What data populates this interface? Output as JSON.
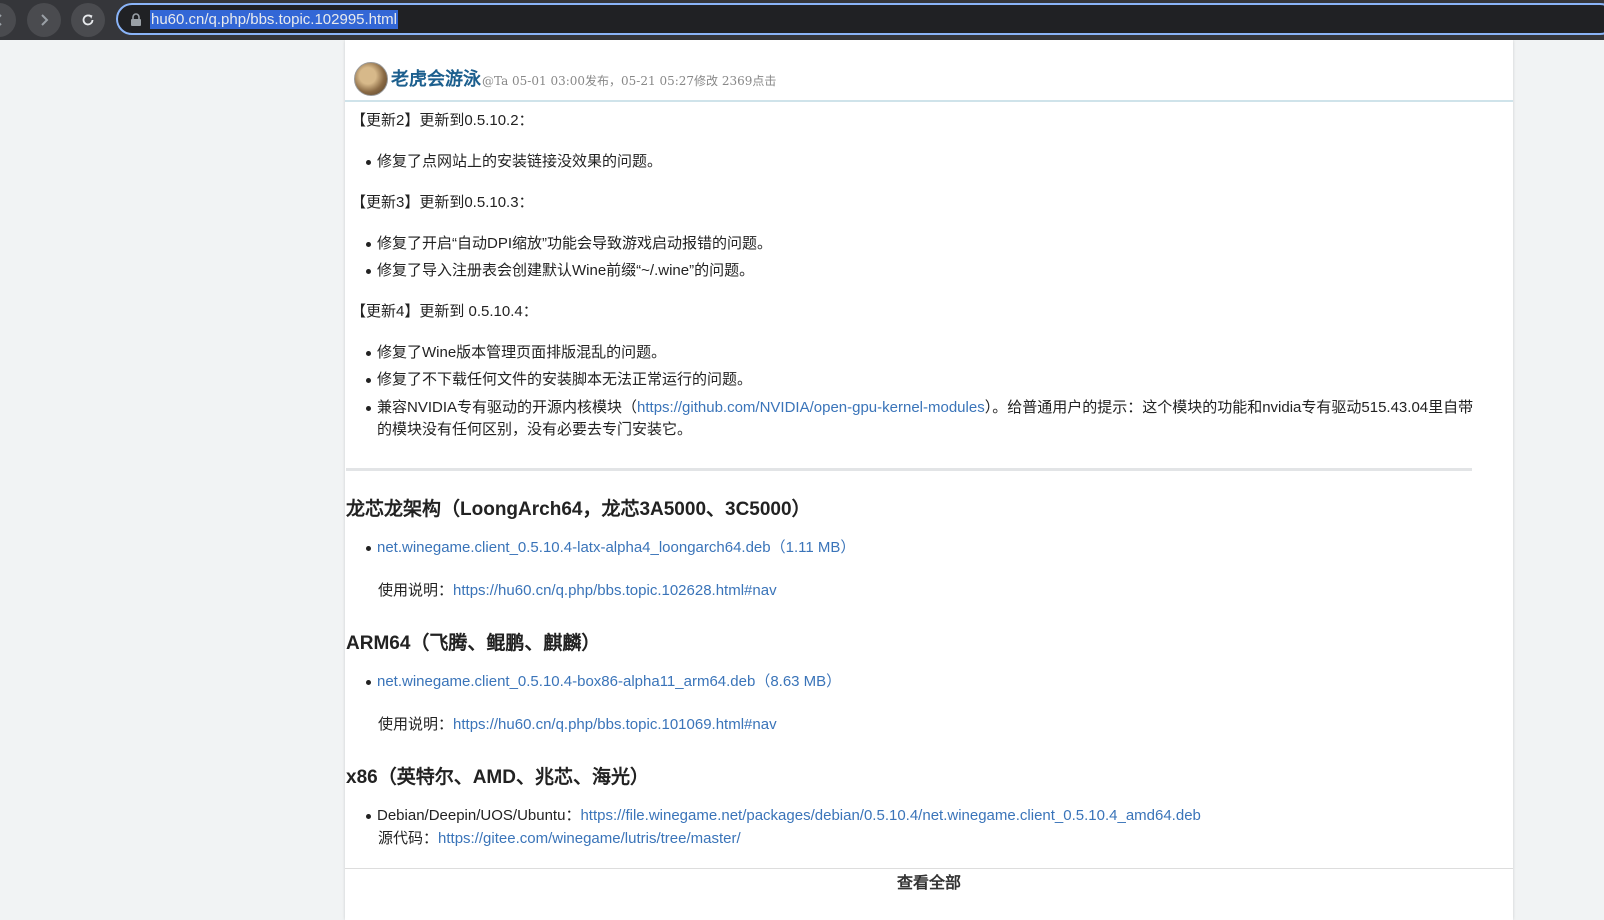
{
  "browser": {
    "url": "hu60.cn/q.php/bbs.topic.102995.html",
    "icons": [
      "back-icon",
      "forward-icon",
      "reload-icon",
      "lock-icon"
    ]
  },
  "post": {
    "author": "老虎会游泳",
    "meta": "@Ta 05-01 03:00发布，05-21 05:27修改 2369点击"
  },
  "updates": [
    {
      "heading": "【更新2】更新到0.5.10.2：",
      "items": [
        "修复了点网站上的安装链接没效果的问题。"
      ]
    },
    {
      "heading": "【更新3】更新到0.5.10.3：",
      "items": [
        "修复了开启“自动DPI缩放”功能会导致游戏启动报错的问题。",
        "修复了导入注册表会创建默认Wine前缀“~/.wine”的问题。"
      ]
    },
    {
      "heading": "【更新4】更新到 0.5.10.4：",
      "items": [
        "修复了Wine版本管理页面排版混乱的问题。",
        "修复了不下载任何文件的安装脚本无法正常运行的问题。"
      ],
      "nvidia_item": {
        "before": "兼容NVIDIA专有驱动的开源内核模块（",
        "link": "https://github.com/NVIDIA/open-gpu-kernel-modules",
        "after": "）。给普通用户的提示：这个模块的功能和nvidia专有驱动515.43.04里自带的模块没有任何区别，没有必要去专门安装它。"
      }
    }
  ],
  "sections": {
    "loong": {
      "title": "龙芯龙架构（LoongArch64，龙芯3A5000、3C5000）",
      "file": "net.winegame.client_0.5.10.4-latx-alpha4_loongarch64.deb（1.11 MB）",
      "usage_label": "使用说明：",
      "usage_link": "https://hu60.cn/q.php/bbs.topic.102628.html#nav"
    },
    "arm": {
      "title": "ARM64（飞腾、鲲鹏、麒麟）",
      "file": "net.winegame.client_0.5.10.4-box86-alpha11_arm64.deb（8.63 MB）",
      "usage_label": "使用说明：",
      "usage_link": "https://hu60.cn/q.php/bbs.topic.101069.html#nav"
    },
    "x86": {
      "title": "x86（英特尔、AMD、兆芯、海光）",
      "debian_label": "Debian/Deepin/UOS/Ubuntu：",
      "debian_link": "https://file.winegame.net/packages/debian/0.5.10.4/net.winegame.client_0.5.10.4_amd64.deb",
      "source_label": "源代码：",
      "source_link": "https://gitee.com/winegame/lutris/tree/master/"
    }
  },
  "view_all": "查看全部",
  "colors": {
    "link": "#3a74b9",
    "author": "#1c5f8e",
    "chrome": "#35363a",
    "focus": "#8ab4f8"
  }
}
